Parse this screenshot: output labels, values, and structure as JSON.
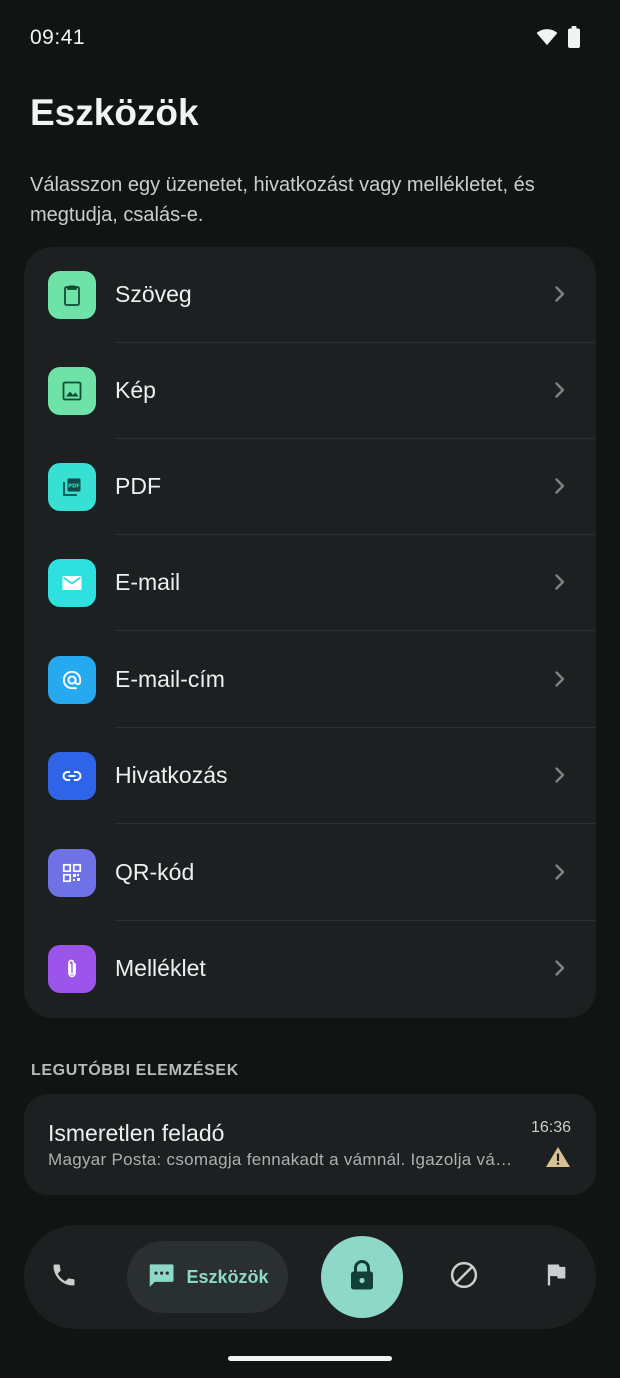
{
  "status_bar": {
    "time": "09:41",
    "icons": [
      "wifi-icon",
      "battery-icon"
    ]
  },
  "header": {
    "title": "Eszközök",
    "subtitle": "Válasszon egy üzenetet, hivatkozást vagy mellékletet, és megtudja, csalás-e."
  },
  "tools": {
    "items": [
      {
        "label": "Szöveg",
        "icon": "clipboard-icon",
        "color": "#6fe3a7"
      },
      {
        "label": "Kép",
        "icon": "image-icon",
        "color": "#6fe3a7"
      },
      {
        "label": "PDF",
        "icon": "pdf-icon",
        "color": "#37e0d2"
      },
      {
        "label": "E-mail",
        "icon": "mail-icon",
        "color": "#2ee0e0"
      },
      {
        "label": "E-mail-cím",
        "icon": "at-sign-icon",
        "color": "#26a9ee"
      },
      {
        "label": "Hivatkozás",
        "icon": "link-icon",
        "color": "#2f63e8"
      },
      {
        "label": "QR-kód",
        "icon": "qr-code-icon",
        "color": "#6f72e6"
      },
      {
        "label": "Melléklet",
        "icon": "paperclip-icon",
        "color": "#9b55ea"
      }
    ]
  },
  "recent": {
    "section_label": "LEGUTÓBBI ELEMZÉSEK",
    "items": [
      {
        "sender": "Ismeretlen feladó",
        "preview": "Magyar Posta: csomagja fennakadt a vámnál. Igazolja vámazonosítóját",
        "time": "16:36",
        "status_icon": "warning-icon",
        "status_color": "#d9c190"
      }
    ]
  },
  "bottom_nav": {
    "items": [
      {
        "icon": "phone-icon"
      },
      {
        "icon": "message-icon",
        "label": "Eszközök",
        "active": true
      },
      {
        "icon": "lock-icon"
      },
      {
        "icon": "block-icon"
      },
      {
        "icon": "flag-icon"
      }
    ],
    "accent": "#8ed8c8"
  }
}
